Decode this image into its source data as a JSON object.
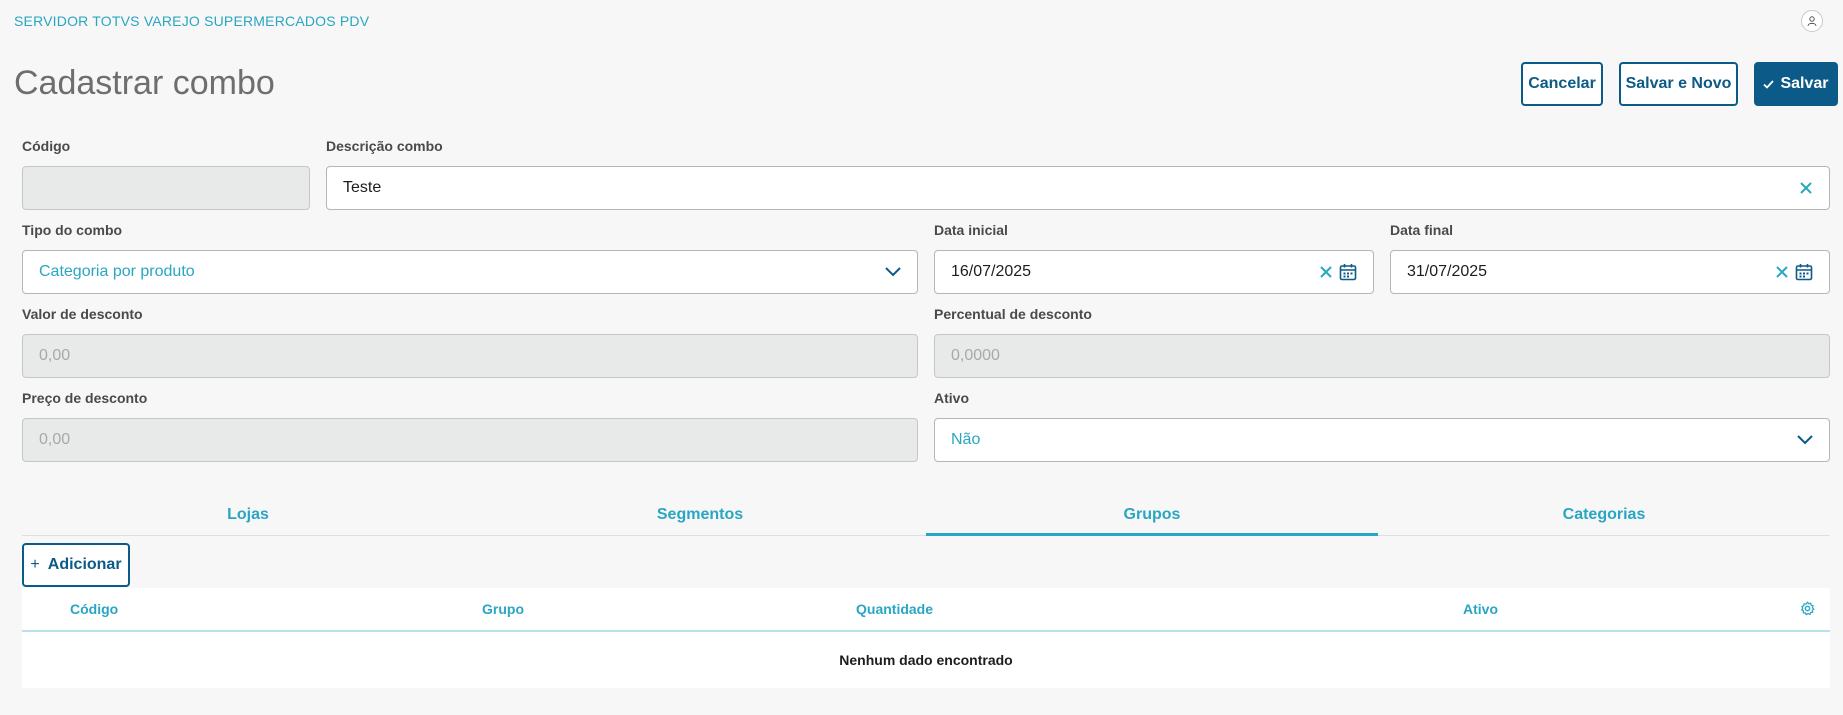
{
  "app": {
    "title": "SERVIDOR TOTVS VAREJO SUPERMERCADOS PDV",
    "accent_color": "#29a6c2",
    "primary_color": "#0c5a87",
    "user_icon": "user-icon"
  },
  "page": {
    "title": "Cadastrar combo"
  },
  "actions": {
    "cancel_label": "Cancelar",
    "save_new_label": "Salvar e Novo",
    "save_label": "Salvar",
    "save_icon": "check-icon"
  },
  "form": {
    "codigo": {
      "label": "Código",
      "value": ""
    },
    "descricao": {
      "label": "Descrição combo",
      "value": "Teste"
    },
    "tipo": {
      "label": "Tipo do combo",
      "value": "Categoria por produto"
    },
    "data_inicial": {
      "label": "Data inicial",
      "value": "16/07/2025"
    },
    "data_final": {
      "label": "Data final",
      "value": "31/07/2025"
    },
    "valor_desconto": {
      "label": "Valor de desconto",
      "placeholder": "0,00"
    },
    "percentual_desconto": {
      "label": "Percentual de desconto",
      "placeholder": "0,0000"
    },
    "preco_desconto": {
      "label": "Preço de desconto",
      "placeholder": "0,00"
    },
    "ativo": {
      "label": "Ativo",
      "value": "Não"
    }
  },
  "tabs": [
    {
      "label": "Lojas",
      "active": false
    },
    {
      "label": "Segmentos",
      "active": false
    },
    {
      "label": "Grupos",
      "active": true
    },
    {
      "label": "Categorias",
      "active": false
    }
  ],
  "grid": {
    "add_label": "Adicionar",
    "columns": [
      "Código",
      "Grupo",
      "Quantidade",
      "Ativo"
    ],
    "empty_message": "Nenhum dado encontrado"
  }
}
